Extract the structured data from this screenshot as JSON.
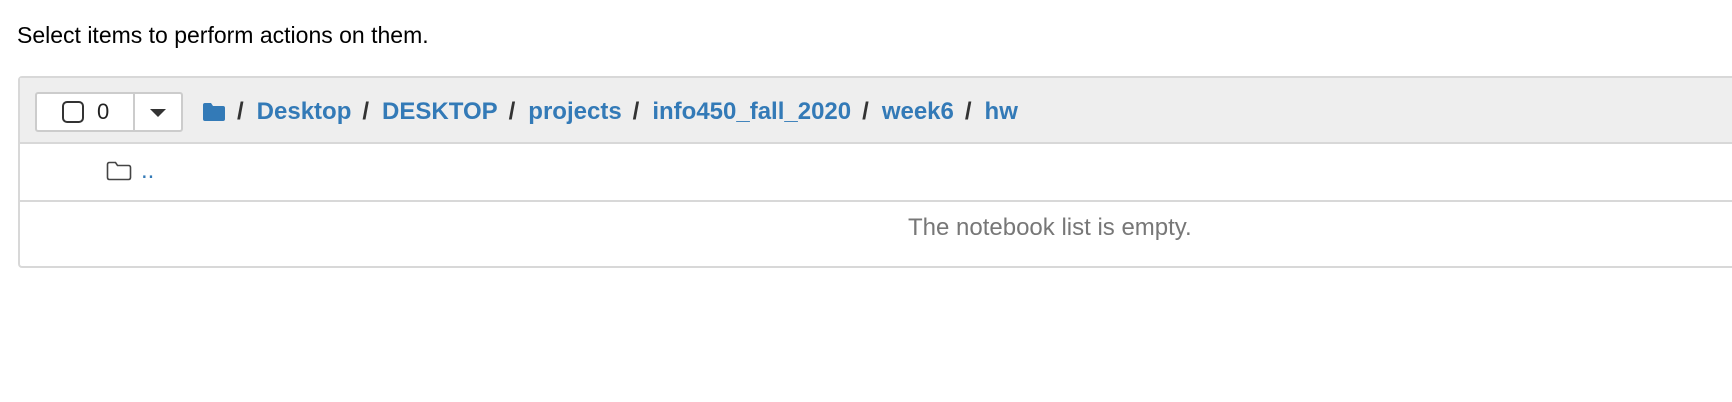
{
  "intro": {
    "text": "Select items to perform actions on them."
  },
  "selection": {
    "count": "0"
  },
  "breadcrumb": {
    "separator": "/",
    "items": [
      "Desktop",
      "DESKTOP",
      "projects",
      "info450_fall_2020",
      "week6",
      "hw"
    ]
  },
  "list": {
    "parent_link": "..",
    "empty_message": "The notebook list is empty."
  },
  "colors": {
    "link": "#337ab7",
    "header_bg": "#eeeeee",
    "border": "#d8d8d8",
    "muted_text": "#777777"
  },
  "icons": {
    "home_folder": "folder-filled-icon",
    "parent_folder": "folder-outline-icon",
    "dropdown": "caret-down-icon"
  }
}
